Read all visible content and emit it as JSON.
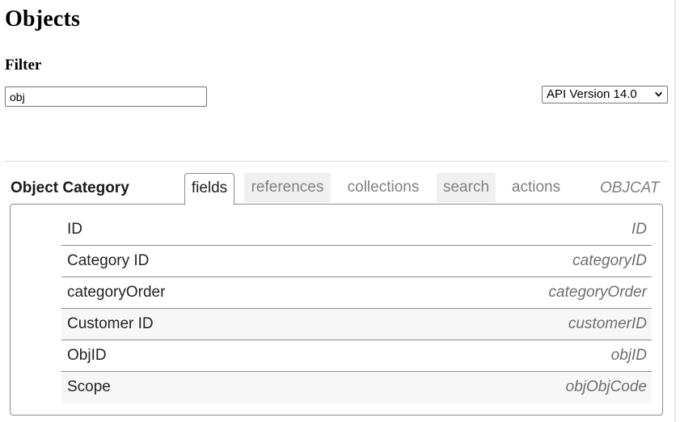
{
  "page": {
    "title": "Objects",
    "filter_label": "Filter",
    "filter_value": "obj",
    "api_version": "API Version 14.0"
  },
  "object": {
    "name": "Object Category",
    "code": "OBJCAT",
    "tabs": [
      {
        "label": "fields",
        "active": true
      },
      {
        "label": "references",
        "active": false
      },
      {
        "label": "collections",
        "active": false
      },
      {
        "label": "search",
        "active": false
      },
      {
        "label": "actions",
        "active": false
      }
    ],
    "fields": [
      {
        "label": "ID",
        "api": "ID"
      },
      {
        "label": "Category ID",
        "api": "categoryID",
        "highlighted": true
      },
      {
        "label": "categoryOrder",
        "api": "categoryOrder"
      },
      {
        "label": "Customer ID",
        "api": "customerID"
      },
      {
        "label": "ObjID",
        "api": "objID"
      },
      {
        "label": "Scope",
        "api": "objObjCode"
      }
    ]
  },
  "colors": {
    "highlight": "#f7ea00",
    "border": "#8c8c8c",
    "muted_text": "#808080"
  }
}
